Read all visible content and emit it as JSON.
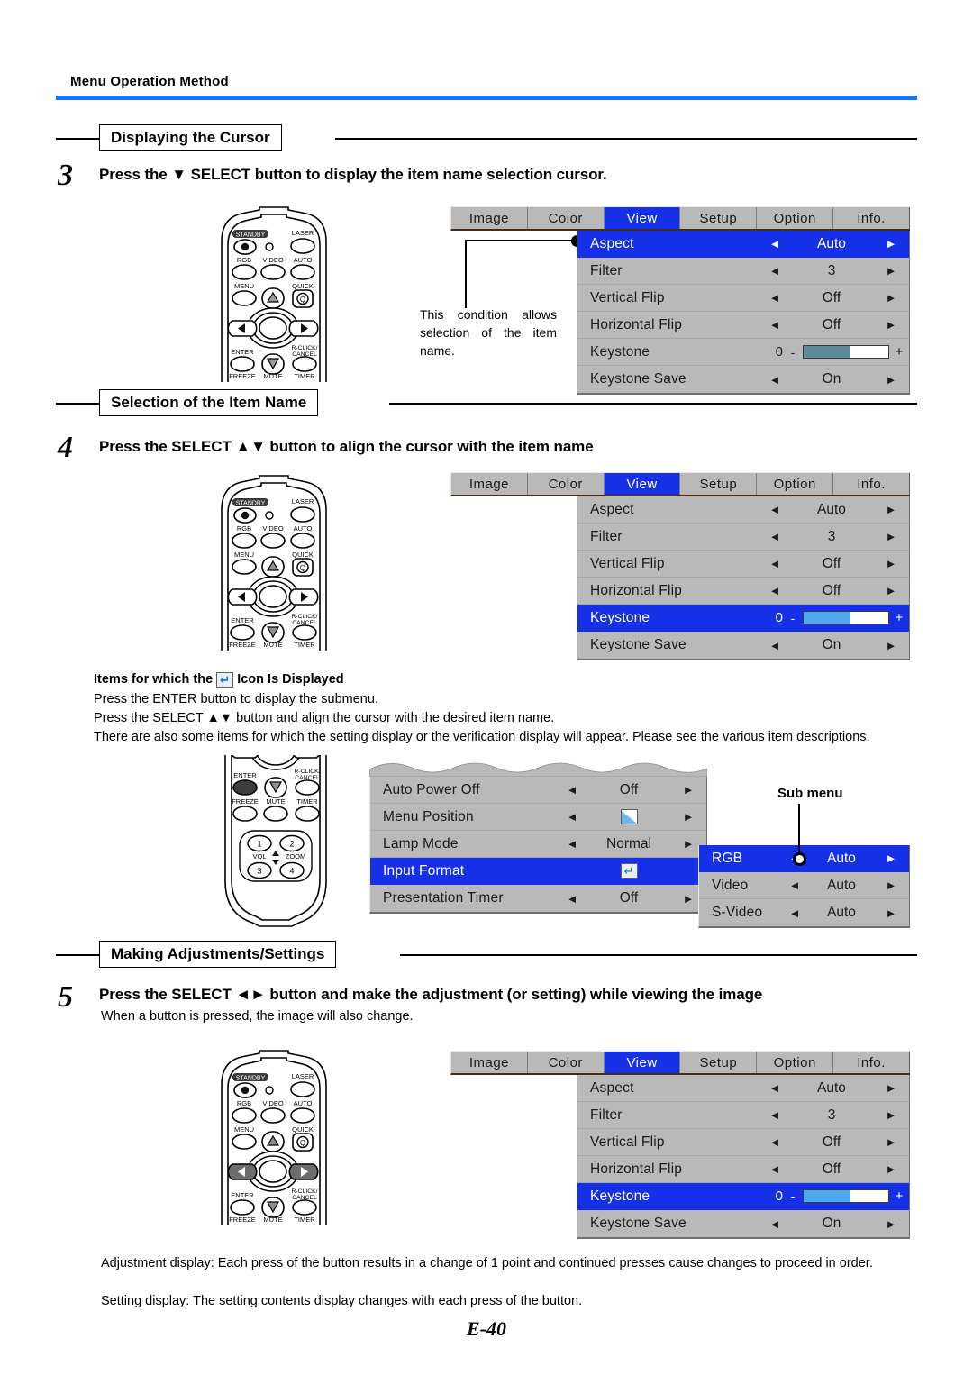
{
  "header": {
    "title": "Menu Operation Method",
    "rule_color": "#1476f0"
  },
  "page_number": "E-40",
  "colors": {
    "menu_highlight": "#1630e8",
    "menu_background": "#b9b9b9",
    "slider_fill_normal": "#5d8a96",
    "slider_fill_selected": "#4fa8ee"
  },
  "sections": [
    {
      "band_label": "Displaying the Cursor",
      "step_number": "3",
      "step_text": "Press the ▼ SELECT button to display the item name selection cursor."
    },
    {
      "band_label": "Selection of the Item Name",
      "step_number": "4",
      "step_text": "Press the SELECT ▲▼ button to align the cursor with the item name"
    },
    {
      "band_label": "Making Adjustments/Settings",
      "step_number": "5",
      "step_text": "Press the SELECT ◄► button and make the adjustment (or setting) while viewing the image",
      "step_sub": "When a button is pressed, the image will also change."
    }
  ],
  "callout": {
    "text": "This condition allows selection of the item name."
  },
  "sub_menu_label": "Sub menu",
  "enter_note": {
    "heading_before": "Items for which the",
    "heading_after": "Icon Is Displayed",
    "line1": "Press the ENTER button to display the submenu.",
    "line2": "Press the SELECT ▲▼ button and align the cursor with the desired item name.",
    "line3": "There are also some items for which the setting display or the verification display will appear. Please see the various item descriptions."
  },
  "footer_notes": {
    "line1": "Adjustment display: Each press of the button results in a change of 1 point and continued presses cause changes to proceed in order.",
    "line2": "Setting display: The setting contents display changes with each press of the button."
  },
  "osd_tabs": [
    "Image",
    "Color",
    "View",
    "Setup",
    "Option",
    "Info."
  ],
  "osd_active_tab": "View",
  "view_menu": {
    "rows": [
      {
        "name": "Aspect",
        "type": "value",
        "value": "Auto"
      },
      {
        "name": "Filter",
        "type": "value",
        "value": "3"
      },
      {
        "name": "Vertical Flip",
        "type": "value",
        "value": "Off"
      },
      {
        "name": "Horizontal Flip",
        "type": "value",
        "value": "Off"
      },
      {
        "name": "Keystone",
        "type": "slider",
        "value": "0",
        "minus": "-",
        "plus": "+",
        "fill_pct": 55
      },
      {
        "name": "Keystone Save",
        "type": "value",
        "value": "On"
      }
    ],
    "selected_step3": "Aspect",
    "selected_step4": "Keystone",
    "selected_step5": "Keystone"
  },
  "setup_menu": {
    "rows": [
      {
        "name": "Auto Power Off",
        "type": "value",
        "value": "Off"
      },
      {
        "name": "Menu Position",
        "type": "icon",
        "icon": "menu-position-icon"
      },
      {
        "name": "Lamp Mode",
        "type": "value",
        "value": "Normal"
      },
      {
        "name": "Input Format",
        "type": "enter",
        "icon": "enter-icon",
        "selected": true
      },
      {
        "name": "Presentation Timer",
        "type": "value",
        "value": "Off"
      }
    ]
  },
  "input_format_submenu": {
    "rows": [
      {
        "name": "RGB",
        "value": "Auto",
        "selected": true
      },
      {
        "name": "Video",
        "value": "Auto",
        "selected": false
      },
      {
        "name": "S-Video",
        "value": "Auto",
        "selected": false
      }
    ]
  },
  "remote": {
    "buttons": {
      "standby": "STANDBY",
      "laser": "LASER",
      "rgb": "RGB",
      "video": "VIDEO",
      "auto": "AUTO",
      "menu": "MENU",
      "quick": "QUICK",
      "quick_glyph": "Q",
      "enter": "ENTER",
      "rclick": "R-CLICK/",
      "cancel": "CANCEL",
      "freeze": "FREEZE",
      "mute": "MUTE",
      "timer": "TIMER",
      "num1": "1",
      "num2": "2",
      "num3": "3",
      "num4": "4",
      "vol": "VOL",
      "zoom": "ZOOM"
    }
  }
}
